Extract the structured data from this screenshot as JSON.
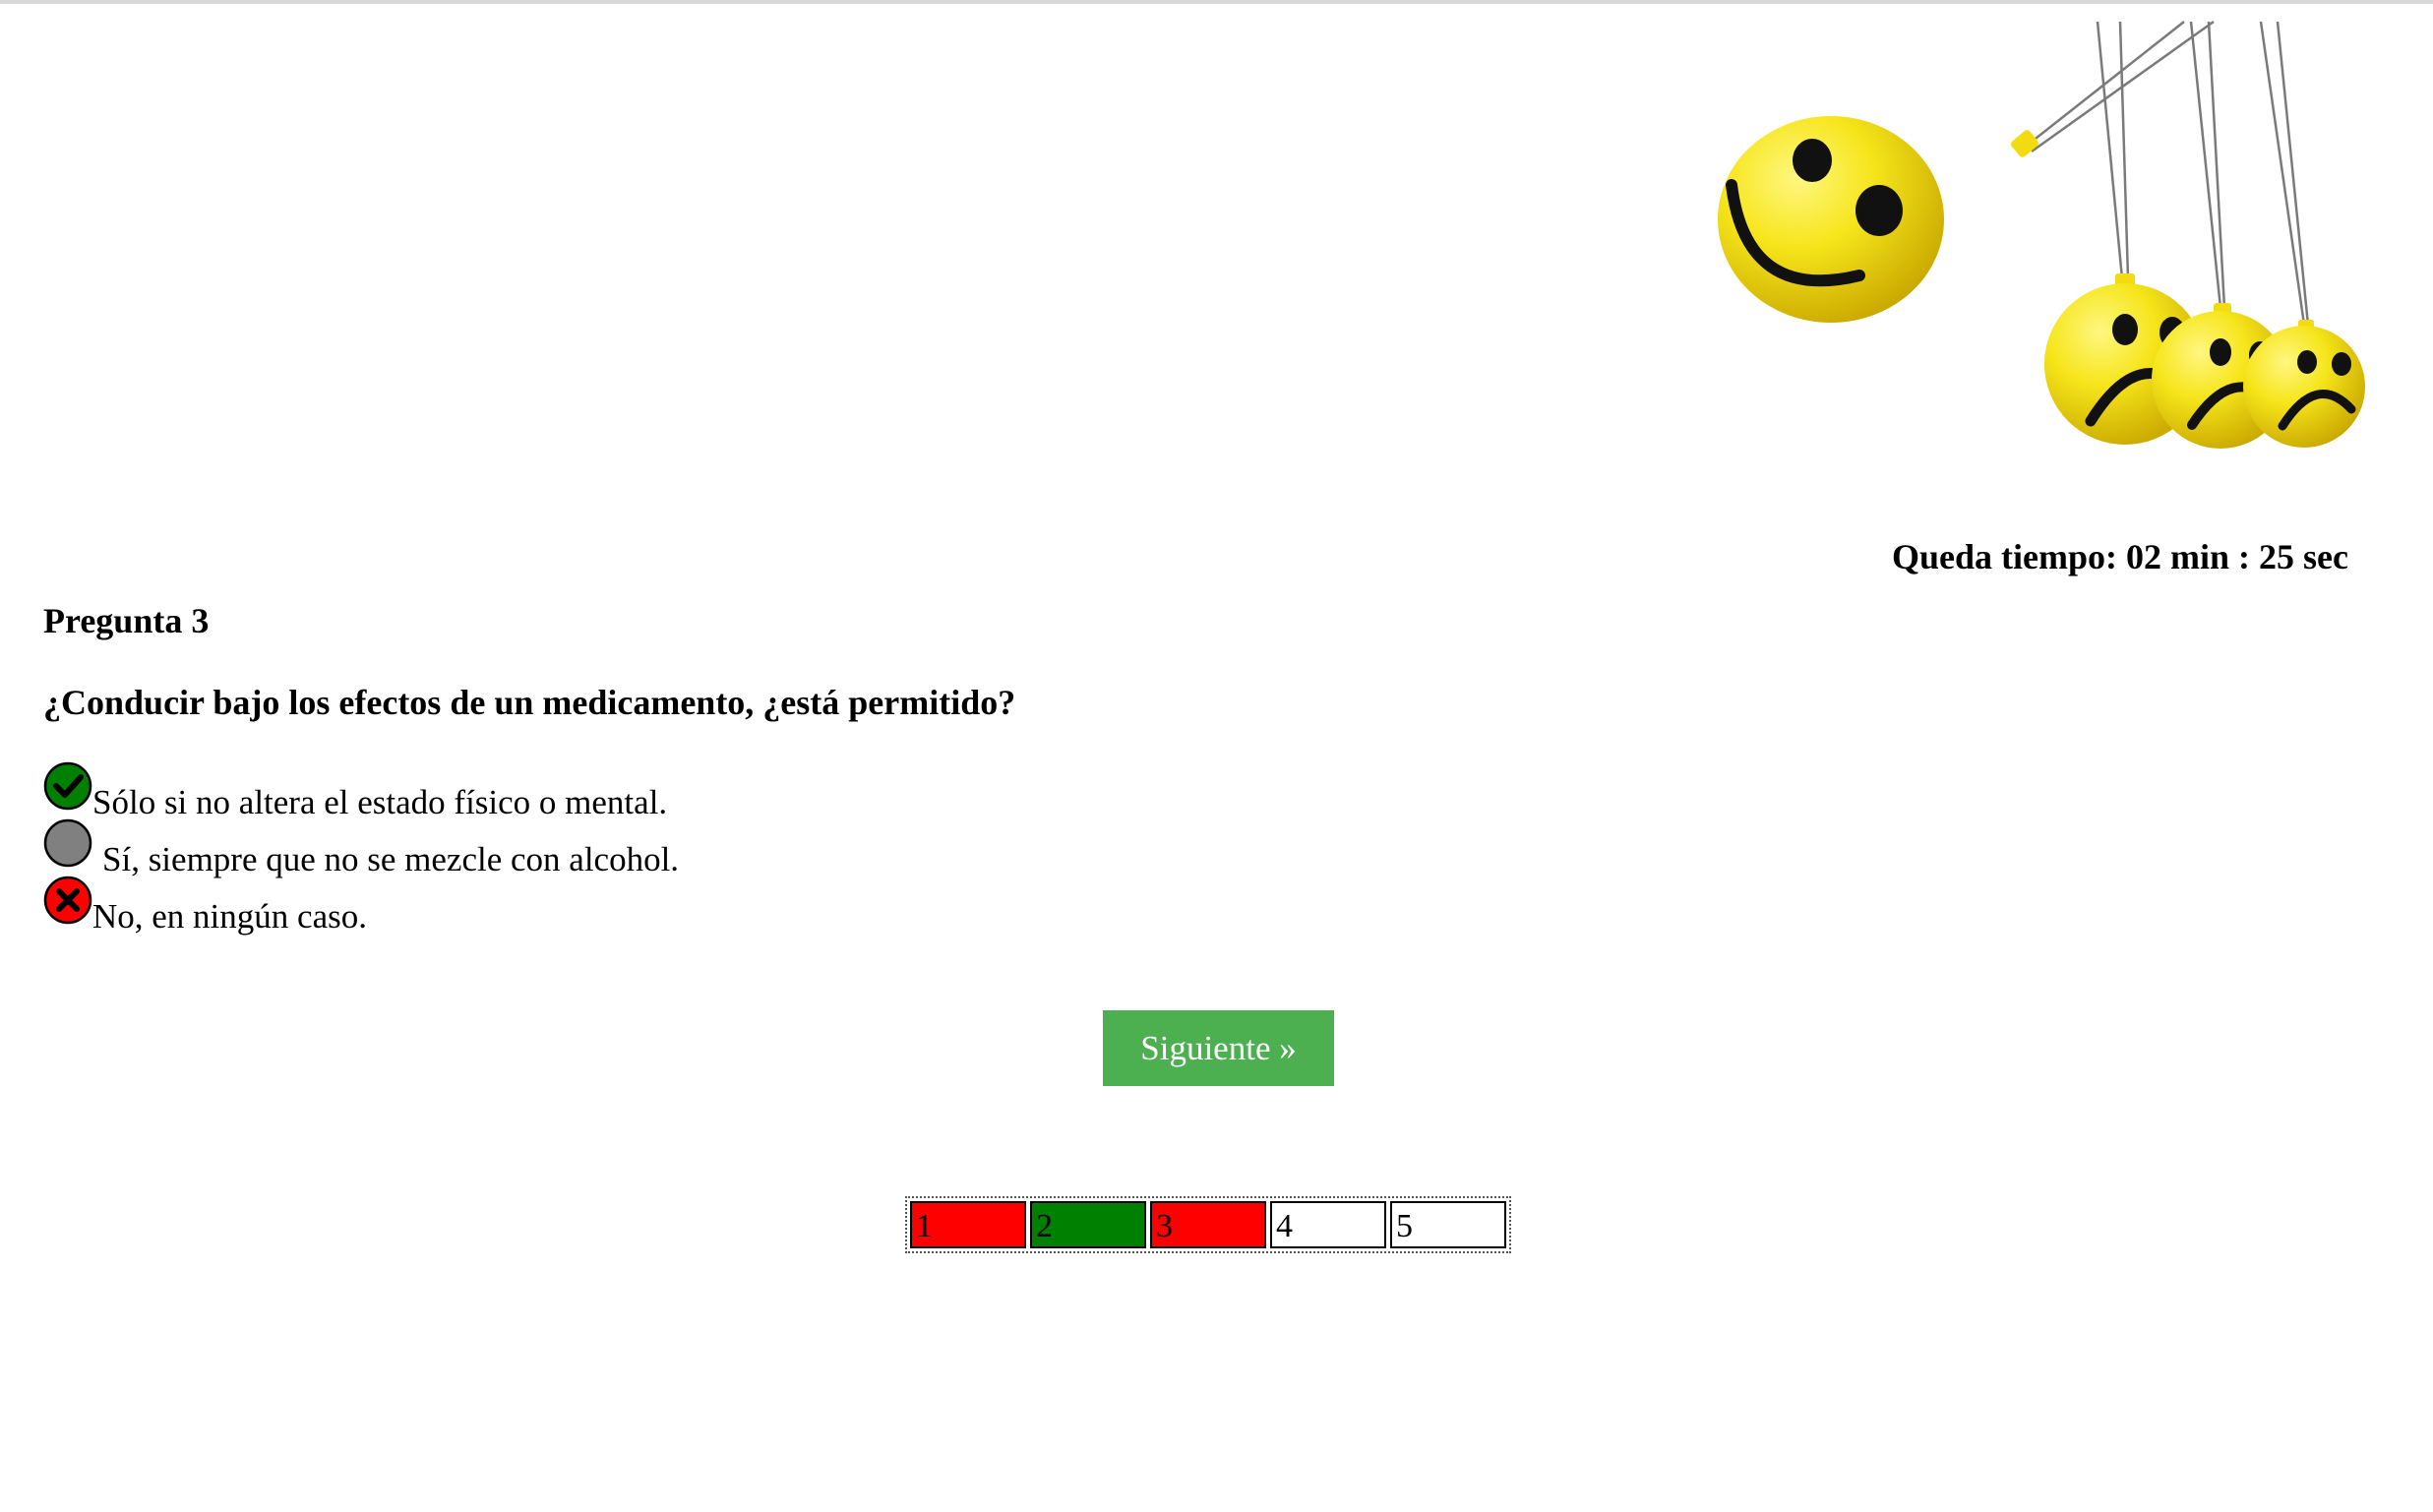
{
  "timer": {
    "text": "Queda tiempo: 02 min : 25 sec"
  },
  "question": {
    "number_label": "Pregunta 3",
    "text": "¿Conducir bajo los efectos de un medicamento, ¿está permitido?"
  },
  "options": [
    {
      "label": "Sólo si no altera el estado físico o mental.",
      "state": "correct",
      "icon": "check-icon",
      "color": "#008000"
    },
    {
      "label": "Sí, siempre que no se mezcle con alcohol.",
      "state": "neutral",
      "icon": "circle-icon",
      "color": "#808080"
    },
    {
      "label": "No, en ningún caso.",
      "state": "wrong",
      "icon": "x-icon",
      "color": "#ff0000"
    }
  ],
  "next_button": {
    "label": "Siguiente »",
    "color": "#4caf50"
  },
  "progress": [
    {
      "label": "1",
      "status": "wrong",
      "color": "#ff0000"
    },
    {
      "label": "2",
      "status": "correct",
      "color": "#008000"
    },
    {
      "label": "3",
      "status": "wrong",
      "color": "#ff0000"
    },
    {
      "label": "4",
      "status": "pending",
      "color": "#ffffff"
    },
    {
      "label": "5",
      "status": "pending",
      "color": "#ffffff"
    }
  ],
  "header_image": {
    "icon": "smiley-newtons-cradle-image"
  }
}
